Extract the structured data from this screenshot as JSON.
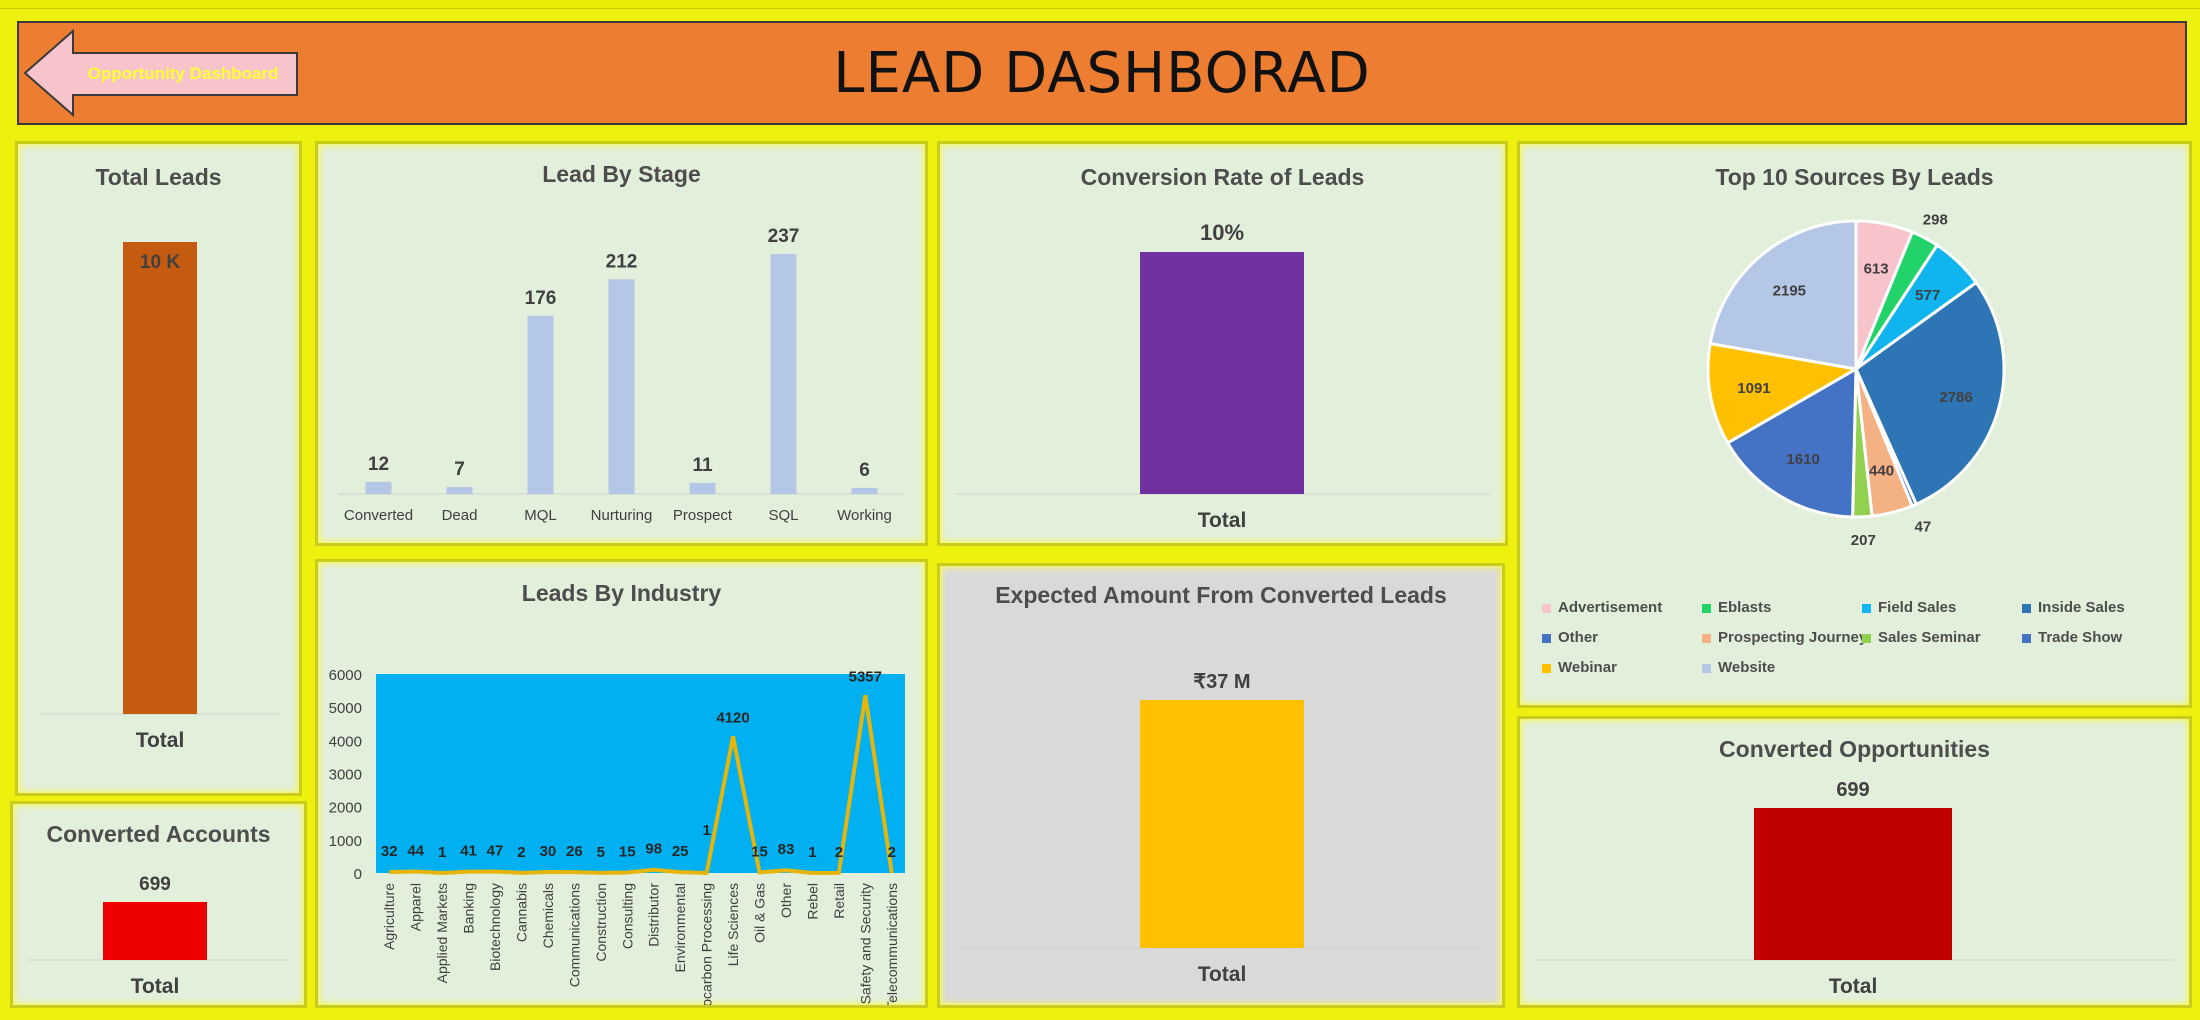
{
  "header": {
    "title": "LEAD DASHBORAD",
    "back_button_label": "Opportunity Dashboard"
  },
  "colors": {
    "background": "#eef00e",
    "header": "#ed7d31",
    "panel": "#e2efda",
    "total_leads_bar": "#c55a11",
    "stage_bar": "#b4c7e7",
    "conversion_bar": "#7030a0",
    "industry_area": "#00b0f0",
    "industry_line": "#e5b50b",
    "expected_bar": "#ffc000",
    "accounts_bar": "#ee0000",
    "opportunities_bar": "#c00000"
  },
  "panels": {
    "total_leads": {
      "title": "Total Leads"
    },
    "lead_by_stage": {
      "title": "Lead By Stage"
    },
    "conversion_rate": {
      "title": "Conversion Rate of Leads"
    },
    "top_sources": {
      "title": "Top 10 Sources By Leads"
    },
    "converted_accounts": {
      "title": "Converted Accounts"
    },
    "leads_by_industry": {
      "title": "Leads By Industry"
    },
    "expected_amount": {
      "title": "Expected Amount From Converted Leads"
    },
    "converted_opportunities": {
      "title": "Converted Opportunities"
    }
  },
  "chart_data": [
    {
      "id": "total_leads",
      "type": "bar",
      "categories": [
        "Total"
      ],
      "values": [
        10000
      ],
      "data_labels": [
        "10 K"
      ]
    },
    {
      "id": "lead_by_stage",
      "type": "bar",
      "categories": [
        "Converted",
        "Dead",
        "MQL",
        "Nurturing",
        "Prospect",
        "SQL",
        "Working"
      ],
      "values": [
        12,
        7,
        176,
        212,
        11,
        237,
        6
      ],
      "data_labels": [
        "12",
        "7",
        "176",
        "212",
        "11",
        "237",
        "6"
      ]
    },
    {
      "id": "conversion_rate",
      "type": "bar",
      "categories": [
        "Total"
      ],
      "values": [
        10
      ],
      "data_labels": [
        "10%"
      ]
    },
    {
      "id": "top_sources",
      "type": "pie",
      "categories": [
        "Advertisement",
        "Eblasts",
        "Field Sales",
        "Inside Sales",
        "Other",
        "Prospecting Journey",
        "Sales Seminar",
        "Trade Show",
        "Webinar",
        "Website"
      ],
      "values": [
        613,
        298,
        577,
        2786,
        47,
        440,
        207,
        1610,
        1091,
        2195
      ],
      "data_labels": [
        "613",
        "298",
        "577",
        "2786",
        "47",
        "440",
        "207",
        "1610",
        "1091",
        "2195"
      ],
      "legend_position": "bottom",
      "colors": [
        "#f8c4cb",
        "#22d36a",
        "#10b4ef",
        "#2e75b6",
        "#4472c4",
        "#f4b183",
        "#92d050",
        "#4472c4",
        "#ffc000",
        "#b4c7e7"
      ]
    },
    {
      "id": "converted_accounts",
      "type": "bar",
      "categories": [
        "Total"
      ],
      "values": [
        699
      ],
      "data_labels": [
        "699"
      ]
    },
    {
      "id": "leads_by_industry",
      "type": "line",
      "categories": [
        "Agriculture",
        "Apparel",
        "Applied Markets",
        "Banking",
        "Biotechnology",
        "Cannabis",
        "Chemicals",
        "Communications",
        "Construction",
        "Consulting",
        "Distributor",
        "Environmental",
        "Hydrocarbon Processing",
        "Life Sciences",
        "Oil & Gas",
        "Other",
        "Rebel",
        "Retail",
        "Safety and Security",
        "Telecommunications"
      ],
      "values": [
        32,
        44,
        1,
        41,
        47,
        2,
        30,
        26,
        5,
        15,
        98,
        25,
        1,
        4120,
        15,
        83,
        1,
        2,
        5357,
        2
      ],
      "data_labels": [
        "32",
        "44",
        "1",
        "41",
        "47",
        "2",
        "30",
        "26",
        "5",
        "15",
        "98",
        "25",
        "1",
        "4120",
        "15",
        "83",
        "1",
        "2",
        "5357",
        "2"
      ],
      "yticks": [
        "0",
        "1000",
        "2000",
        "3000",
        "4000",
        "5000",
        "6000"
      ],
      "ylim": [
        0,
        6000
      ]
    },
    {
      "id": "expected_amount",
      "type": "bar",
      "categories": [
        "Total"
      ],
      "values": [
        37
      ],
      "data_labels": [
        "₹37 M"
      ]
    },
    {
      "id": "converted_opportunities",
      "type": "bar",
      "categories": [
        "Total"
      ],
      "values": [
        699
      ],
      "data_labels": [
        "699"
      ]
    }
  ]
}
